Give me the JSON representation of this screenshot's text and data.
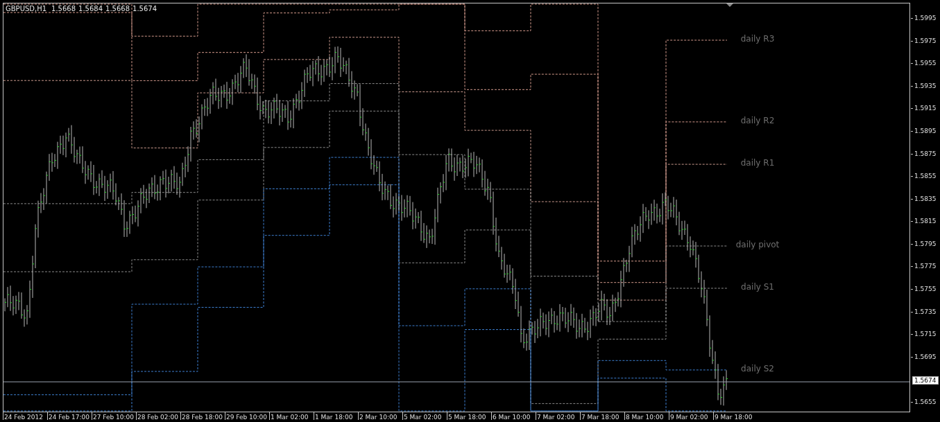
{
  "chart": {
    "symbol": "GBPUSD,H1",
    "ohlc": [
      "1.5668",
      "1.5684",
      "1.5668",
      "1.5674"
    ],
    "level_labels": [
      "daily R3",
      "daily R2",
      "daily R1",
      "daily pivot",
      "daily S1",
      "daily S2"
    ],
    "price_axis": [
      "1.5995",
      "1.5975",
      "1.5955",
      "1.5935",
      "1.5915",
      "1.5895",
      "1.5875",
      "1.5855",
      "1.5835",
      "1.5815",
      "1.5795",
      "1.5775",
      "1.5755",
      "1.5735",
      "1.5715",
      "1.5695",
      "1.5655"
    ],
    "current_price": "1.5674",
    "time_axis": [
      "24 Feb 2012",
      "24 Feb 17:00",
      "27 Feb 10:00",
      "28 Feb 02:00",
      "28 Feb 18:00",
      "29 Feb 10:00",
      "1 Mar 02:00",
      "1 Mar 18:00",
      "2 Mar 10:00",
      "5 Mar 02:00",
      "5 Mar 18:00",
      "6 Mar 10:00",
      "7 Mar 02:00",
      "7 Mar 18:00",
      "8 Mar 10:00",
      "9 Mar 02:00",
      "9 Mar 18:00"
    ]
  }
}
